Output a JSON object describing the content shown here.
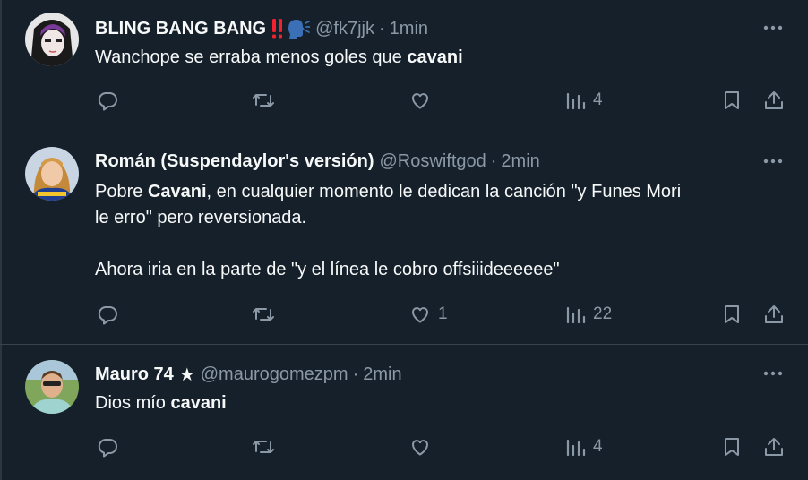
{
  "tweets": [
    {
      "name": "BLING BANG BANG",
      "emoji": "‼️🗣️",
      "handle": "@fk7jjk",
      "dot": "·",
      "time": "1min",
      "text_pre": "Wanchope se erraba menos goles que ",
      "text_bold": "cavani",
      "text_post": "",
      "replies": "",
      "retweets": "",
      "likes": "",
      "views": "4"
    },
    {
      "name": "Román (Suspendaylor's versión)",
      "handle": "@Roswiftgod",
      "dot": "·",
      "time": "2min",
      "line1_pre": "Pobre ",
      "line1_bold": "Cavani",
      "line1_post": ", en cualquier momento le dedican la canción \"y Funes Mori",
      "line2": "le erro\" pero reversionada.",
      "line3": "Ahora iria en la parte de \"y el línea le cobro offsiiideeeeee\"",
      "replies": "",
      "retweets": "",
      "likes": "1",
      "views": "22"
    },
    {
      "name": "Mauro 74",
      "star": "★",
      "handle": "@maurogomezpm",
      "dot": "·",
      "time": "2min",
      "text_pre": "Dios mío ",
      "text_bold": "cavani",
      "text_post": "",
      "replies": "",
      "retweets": "",
      "likes": "",
      "views": "4"
    }
  ],
  "icons": {
    "reply": "reply-icon",
    "retweet": "retweet-icon",
    "like": "heart-icon",
    "views": "views-icon",
    "bookmark": "bookmark-icon",
    "share": "share-icon",
    "more": "more-icon"
  },
  "colors": {
    "background": "#15202b",
    "text": "#f7f9f9",
    "muted": "#8b98a5",
    "divider": "#38444d",
    "alert": "#f4212e"
  }
}
